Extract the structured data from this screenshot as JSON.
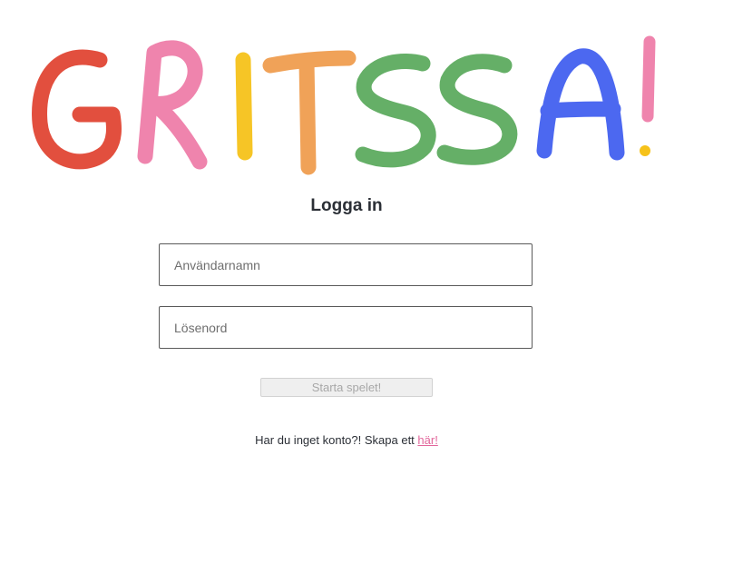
{
  "logo": {
    "text": "GRITSSA!",
    "letters": [
      {
        "char": "G",
        "color": "#e0402e"
      },
      {
        "char": "R",
        "color": "#ee7aa6"
      },
      {
        "char": "I",
        "color": "#f6c21a"
      },
      {
        "char": "T",
        "color": "#ef9a4a"
      },
      {
        "char": "S",
        "color": "#58a85a"
      },
      {
        "char": "S",
        "color": "#58a85a"
      },
      {
        "char": "A",
        "color": "#3d5bef"
      },
      {
        "char": "!",
        "color": "#ee7aa6",
        "dot_color": "#f6c21a"
      }
    ]
  },
  "login": {
    "title": "Logga in",
    "username_placeholder": "Användarnamn",
    "password_placeholder": "Lösenord",
    "start_button": "Starta spelet!"
  },
  "signup": {
    "prompt": "Har du inget konto?! Skapa ett ",
    "link": "här!",
    "link_color": "#e2669b"
  }
}
